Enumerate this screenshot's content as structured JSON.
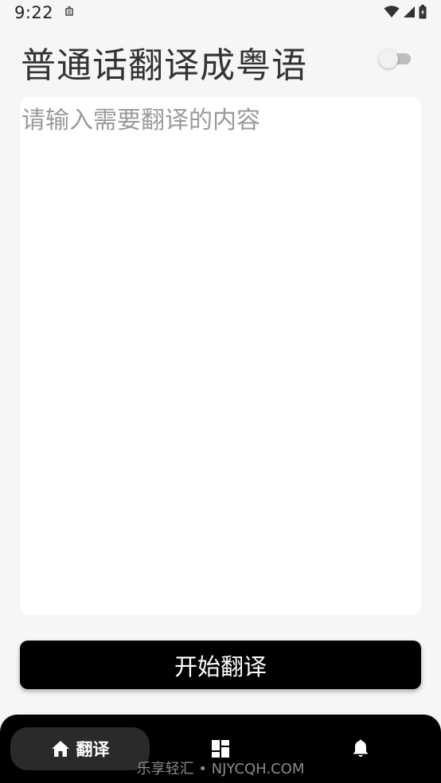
{
  "status_bar": {
    "time": "9:22"
  },
  "header": {
    "title": "普通话翻译成粤语",
    "toggle_on": false
  },
  "input": {
    "placeholder": "请输入需要翻译的内容",
    "value": ""
  },
  "actions": {
    "translate_label": "开始翻译"
  },
  "bottom_nav": {
    "items": [
      {
        "icon": "home-icon",
        "label": "翻译",
        "active": true
      },
      {
        "icon": "dashboard-icon",
        "label": "",
        "active": false
      },
      {
        "icon": "bell-icon",
        "label": "",
        "active": false
      }
    ]
  },
  "watermark": {
    "text": "乐享轻汇 • NJYCQH.COM"
  },
  "colors": {
    "background": "#f6f6f6",
    "primary": "#000000",
    "title_text": "#333333",
    "placeholder": "#9a9a9a"
  }
}
